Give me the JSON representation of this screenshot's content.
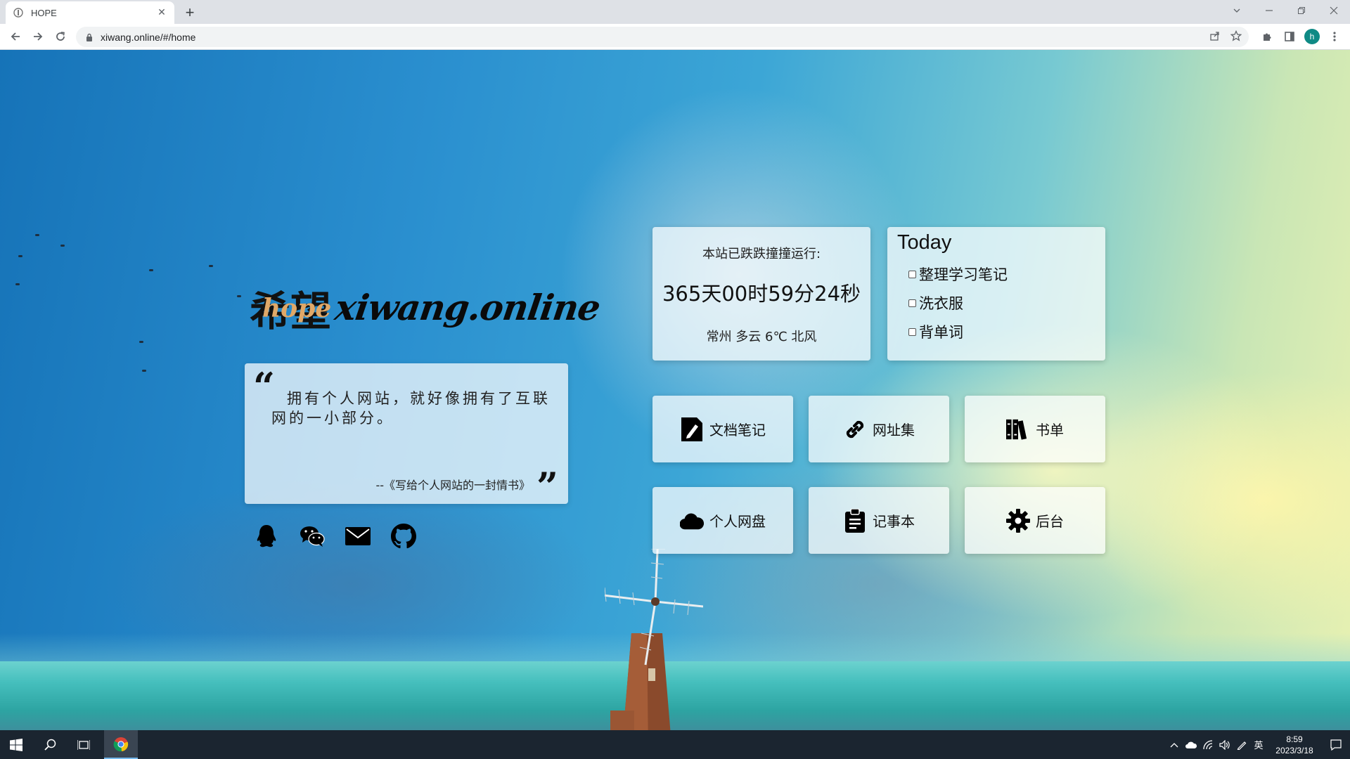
{
  "browser": {
    "tab_title": "HOPE",
    "url": "xiwang.online/#/home",
    "profile_initial": "h"
  },
  "logo": {
    "cn_text": "希望",
    "overlay_text": "hope",
    "site_name": "xiwang.online"
  },
  "quote": {
    "text": "拥有个人网站，就好像拥有了互联网的一小部分。",
    "source": "--《写给个人网站的一封情书》"
  },
  "social": [
    "qq-icon",
    "wechat-icon",
    "mail-icon",
    "github-icon"
  ],
  "runtime": {
    "label": "本站已跌跌撞撞运行:",
    "value": "365天00时59分24秒",
    "weather": "常州 多云 6℃ 北风"
  },
  "today": {
    "title": "Today",
    "items": [
      "整理学习笔记",
      "洗衣服",
      "背单词"
    ]
  },
  "nav": [
    {
      "label": "文档笔记",
      "icon": "document-pen-icon"
    },
    {
      "label": "网址集",
      "icon": "link-icon"
    },
    {
      "label": "书单",
      "icon": "books-icon"
    },
    {
      "label": "个人网盘",
      "icon": "cloud-icon"
    },
    {
      "label": "记事本",
      "icon": "clipboard-icon"
    },
    {
      "label": "后台",
      "icon": "gear-icon"
    }
  ],
  "taskbar": {
    "time": "8:59",
    "date": "2023/3/18",
    "ime": "英"
  }
}
